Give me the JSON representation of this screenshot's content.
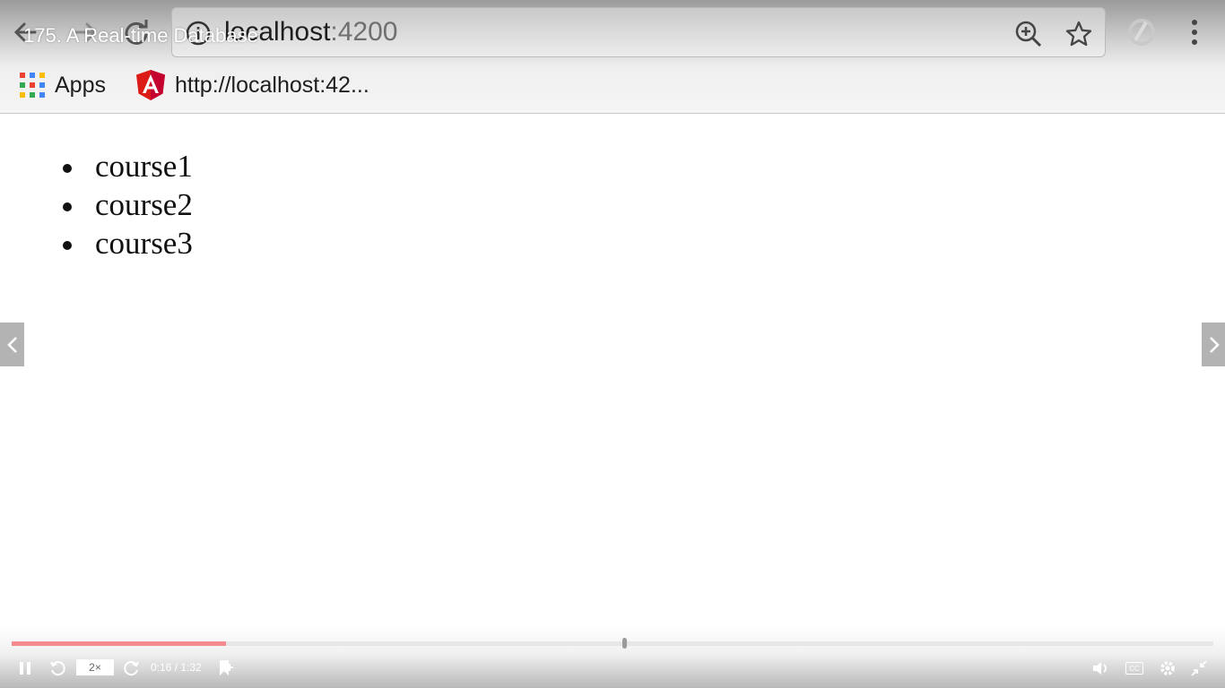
{
  "browser": {
    "url_host": "localhost",
    "url_port": ":4200",
    "bookmarks": [
      {
        "label": "Apps",
        "icon": "apps-grid-icon"
      },
      {
        "label": "http://localhost:42...",
        "icon": "angular-logo-icon"
      }
    ]
  },
  "video": {
    "title": "175. A Real-time Database",
    "speed": "2×",
    "time": "0:16 / 1:32",
    "progress_fraction": 0.178,
    "buffered_handle_fraction": 0.508
  },
  "page": {
    "courses": [
      "course1",
      "course2",
      "course3"
    ]
  },
  "colors": {
    "progress": "#f58a8f",
    "angular_red": "#dd1b16"
  }
}
